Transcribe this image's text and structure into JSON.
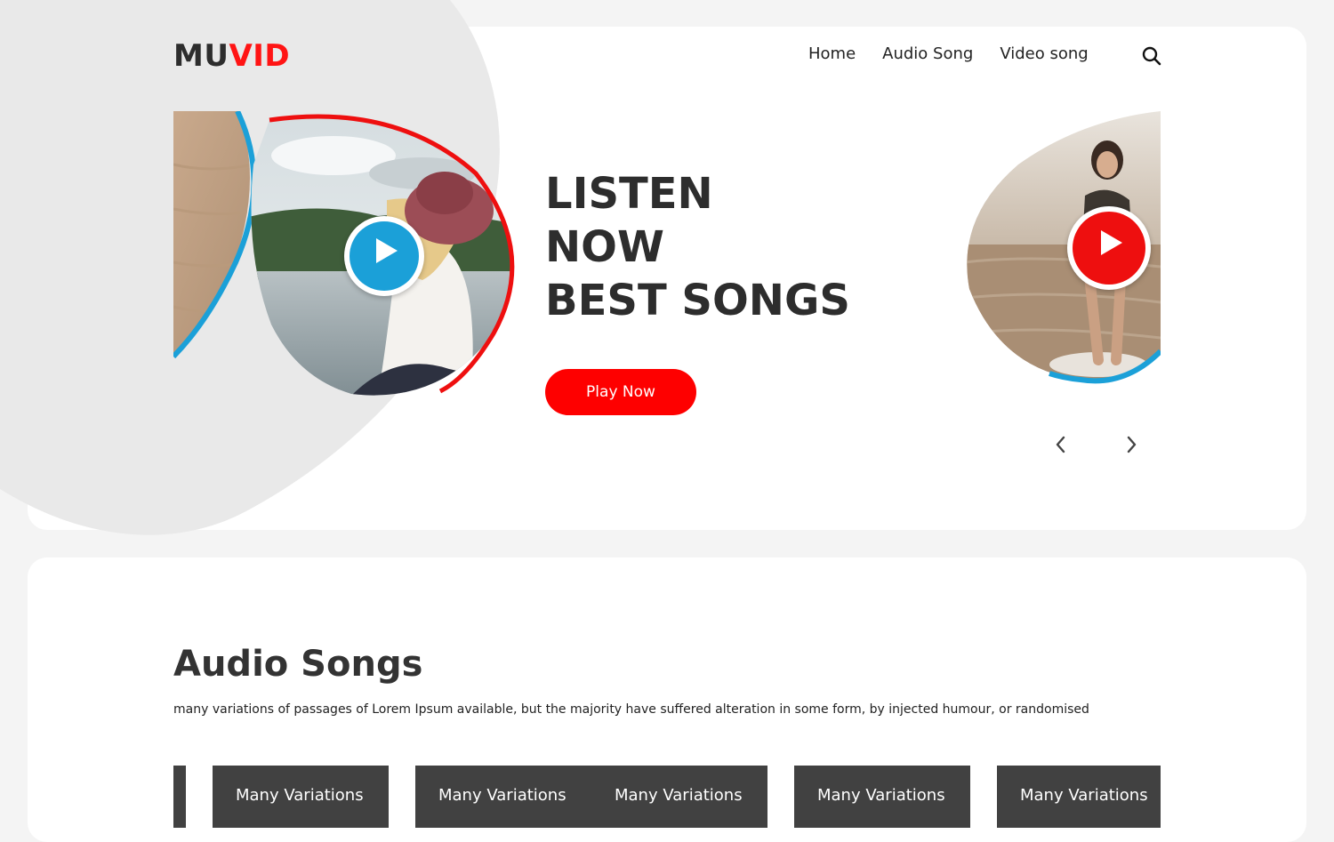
{
  "brand": {
    "part1": "MU",
    "part2": "VID"
  },
  "nav": {
    "items": [
      "Home",
      "Audio Song",
      "Video song"
    ]
  },
  "icons": {
    "search": "search-icon",
    "play": "play-icon",
    "prev": "chevron-left-icon",
    "next": "chevron-right-icon"
  },
  "colors": {
    "accent_red": "#fe0000",
    "accent_blue": "#1ba0d8",
    "text_dark": "#2d2d2d",
    "tile_bg": "#414141",
    "page_bg": "#f4f4f4"
  },
  "hero": {
    "headline": [
      "LISTEN",
      "NOW",
      "BEST SONGS"
    ],
    "cta_label": "Play Now"
  },
  "audio_section": {
    "title": "Audio Songs",
    "description": "many variations of passages of Lorem Ipsum available, but the majority have suffered alteration in some form, by injected humour, or randomised",
    "tiles": [
      "Many Variations",
      "Many Variations",
      "Many Variations",
      "Many Variations",
      "Many Variations"
    ]
  }
}
